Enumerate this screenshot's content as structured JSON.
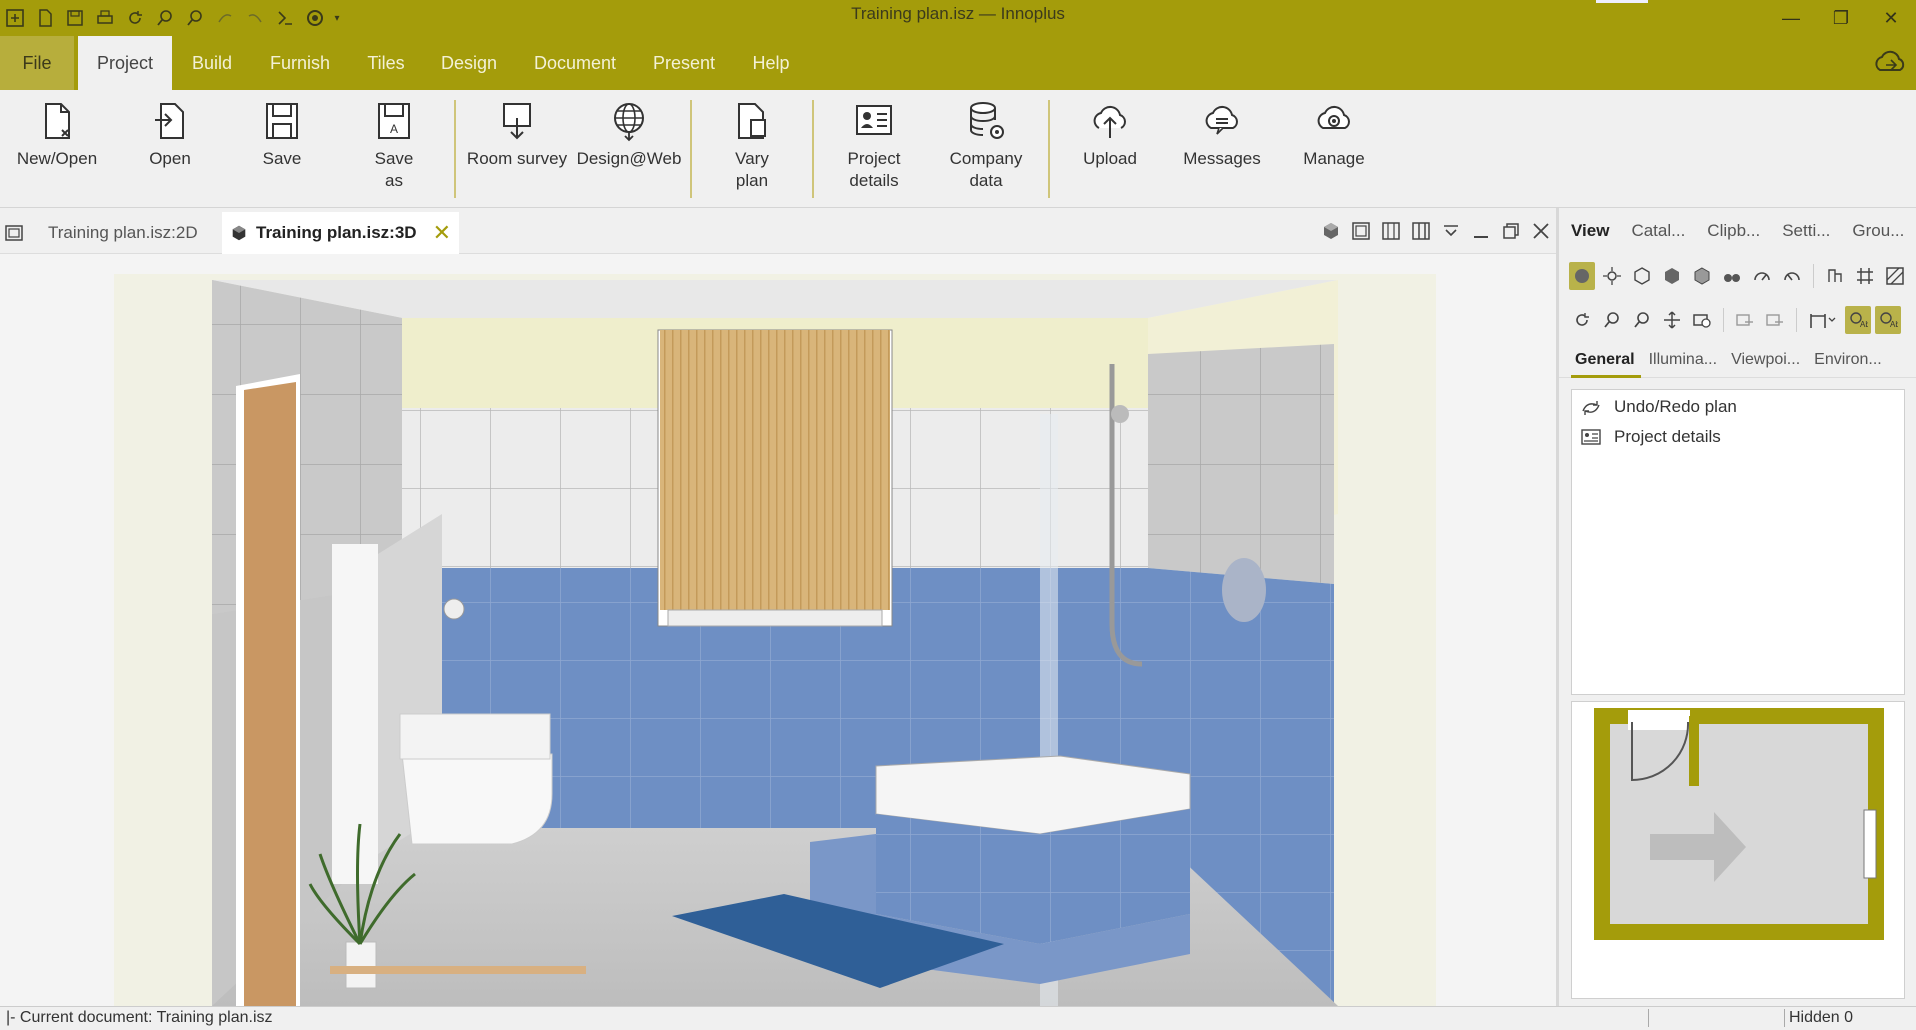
{
  "window": {
    "title": "Training plan.isz — Innoplus"
  },
  "quick_access": [
    "new-icon",
    "save-icon",
    "print-icon",
    "refresh-icon",
    "zoom-icon",
    "search-icon",
    "undo-icon",
    "redo-icon",
    "export-icon",
    "record-icon"
  ],
  "menu": {
    "items": [
      {
        "label": "File"
      },
      {
        "label": "Project"
      },
      {
        "label": "Build"
      },
      {
        "label": "Furnish"
      },
      {
        "label": "Tiles"
      },
      {
        "label": "Design"
      },
      {
        "label": "Document"
      },
      {
        "label": "Present"
      },
      {
        "label": "Help"
      }
    ],
    "active": "Project"
  },
  "ribbon": {
    "buttons": [
      {
        "label": "New/Open",
        "icon": "new-document-icon"
      },
      {
        "label": "Open",
        "icon": "open-icon"
      },
      {
        "label": "Save",
        "icon": "save-icon"
      },
      {
        "label": "Save\nas",
        "icon": "save-as-icon"
      },
      {
        "label": "Room survey",
        "icon": "room-survey-icon"
      },
      {
        "label": "Design@Web",
        "icon": "globe-icon"
      },
      {
        "label": "Vary\nplan",
        "icon": "vary-plan-icon"
      },
      {
        "label": "Project\ndetails",
        "icon": "project-details-icon"
      },
      {
        "label": "Company\ndata",
        "icon": "company-data-icon"
      },
      {
        "label": "Upload",
        "icon": "upload-icon"
      },
      {
        "label": "Messages",
        "icon": "messages-icon"
      },
      {
        "label": "Manage",
        "icon": "manage-icon"
      }
    ]
  },
  "doc_tabs": [
    {
      "label": "Training plan.isz:2D",
      "active": false
    },
    {
      "label": "Training plan.isz:3D",
      "active": true
    }
  ],
  "right_panel": {
    "tabs": [
      "View",
      "Catal...",
      "Clipb...",
      "Setti...",
      "Grou..."
    ],
    "active_tab": "View",
    "subtabs": [
      "General",
      "Illumina...",
      "Viewpoi...",
      "Environ..."
    ],
    "active_subtab": "General",
    "list": [
      {
        "label": "Undo/Redo plan",
        "icon": "undo-redo-icon"
      },
      {
        "label": "Project details",
        "icon": "project-details-icon"
      }
    ]
  },
  "status": {
    "left": "|- Current document: Training plan.isz",
    "right": "Hidden 0"
  },
  "colors": {
    "accent": "#a49c0b",
    "wall_tile_blue": "#6e8fc4",
    "wall_tile_white": "#e8e8e8",
    "blind_wood": "#d9b57a"
  }
}
